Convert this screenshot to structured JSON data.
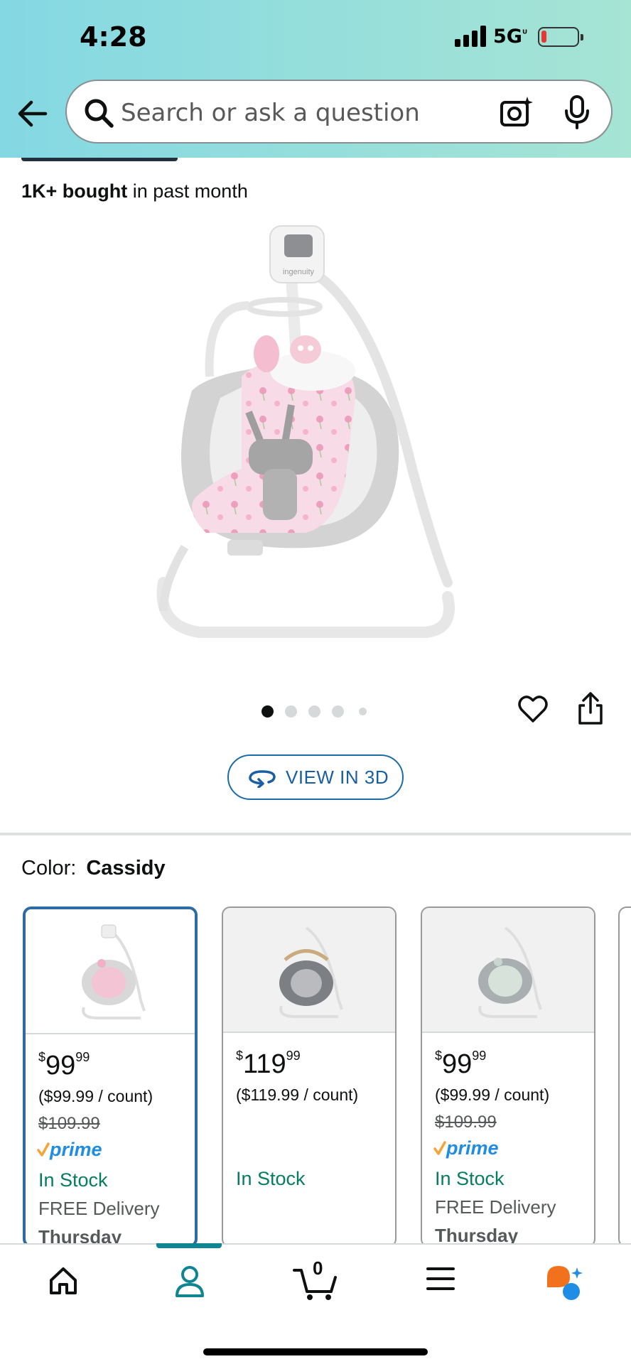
{
  "status_bar": {
    "time": "4:28",
    "network": "5G UC"
  },
  "search": {
    "placeholder": "Search or ask a question"
  },
  "product": {
    "bought_count": "1K+ bought",
    "bought_suffix": " in past month",
    "image_brand": "ingenuity",
    "image_count": 5,
    "active_image_index": 0,
    "view_3d_label": "VIEW IN 3D"
  },
  "color": {
    "label": "Color:",
    "value": "Cassidy"
  },
  "swatches": [
    {
      "price_symbol": "$",
      "price_whole": "99",
      "price_fraction": "99",
      "unit_price": "($99.99 / count)",
      "was_price": "$109.99",
      "prime": "prime",
      "stock": "In Stock",
      "delivery": "FREE Delivery",
      "day": "Thursday",
      "selected": true,
      "accent": "#f2b9cf"
    },
    {
      "price_symbol": "$",
      "price_whole": "119",
      "price_fraction": "99",
      "unit_price": "($119.99 / count)",
      "was_price": "",
      "prime": "",
      "stock": "In Stock",
      "delivery": "",
      "day": "",
      "selected": false,
      "accent": "#6b6e73"
    },
    {
      "price_symbol": "$",
      "price_whole": "99",
      "price_fraction": "99",
      "unit_price": "($99.99 / count)",
      "was_price": "$109.99",
      "prime": "prime",
      "stock": "In Stock",
      "delivery": "FREE Delivery",
      "day": "Thursday",
      "selected": false,
      "accent": "#b9c3bd"
    }
  ],
  "bottom_nav": {
    "cart_count": "0",
    "active_tab": "account"
  },
  "colors": {
    "header_start": "#84d8e3",
    "header_end": "#a6e4d4",
    "link_blue": "#1b5fa3",
    "in_stock_green": "#067d62",
    "prime_blue": "#1f8ce6",
    "nav_accent": "#0f8594",
    "rufus_orange": "#f2711c",
    "rufus_blue": "#1f8ce6"
  },
  "icons": [
    "back-arrow-icon",
    "search-icon",
    "camera-icon",
    "mic-icon",
    "heart-icon",
    "share-icon",
    "rotate-3d-icon",
    "home-icon",
    "account-icon",
    "cart-icon",
    "menu-icon",
    "rufus-icon"
  ]
}
